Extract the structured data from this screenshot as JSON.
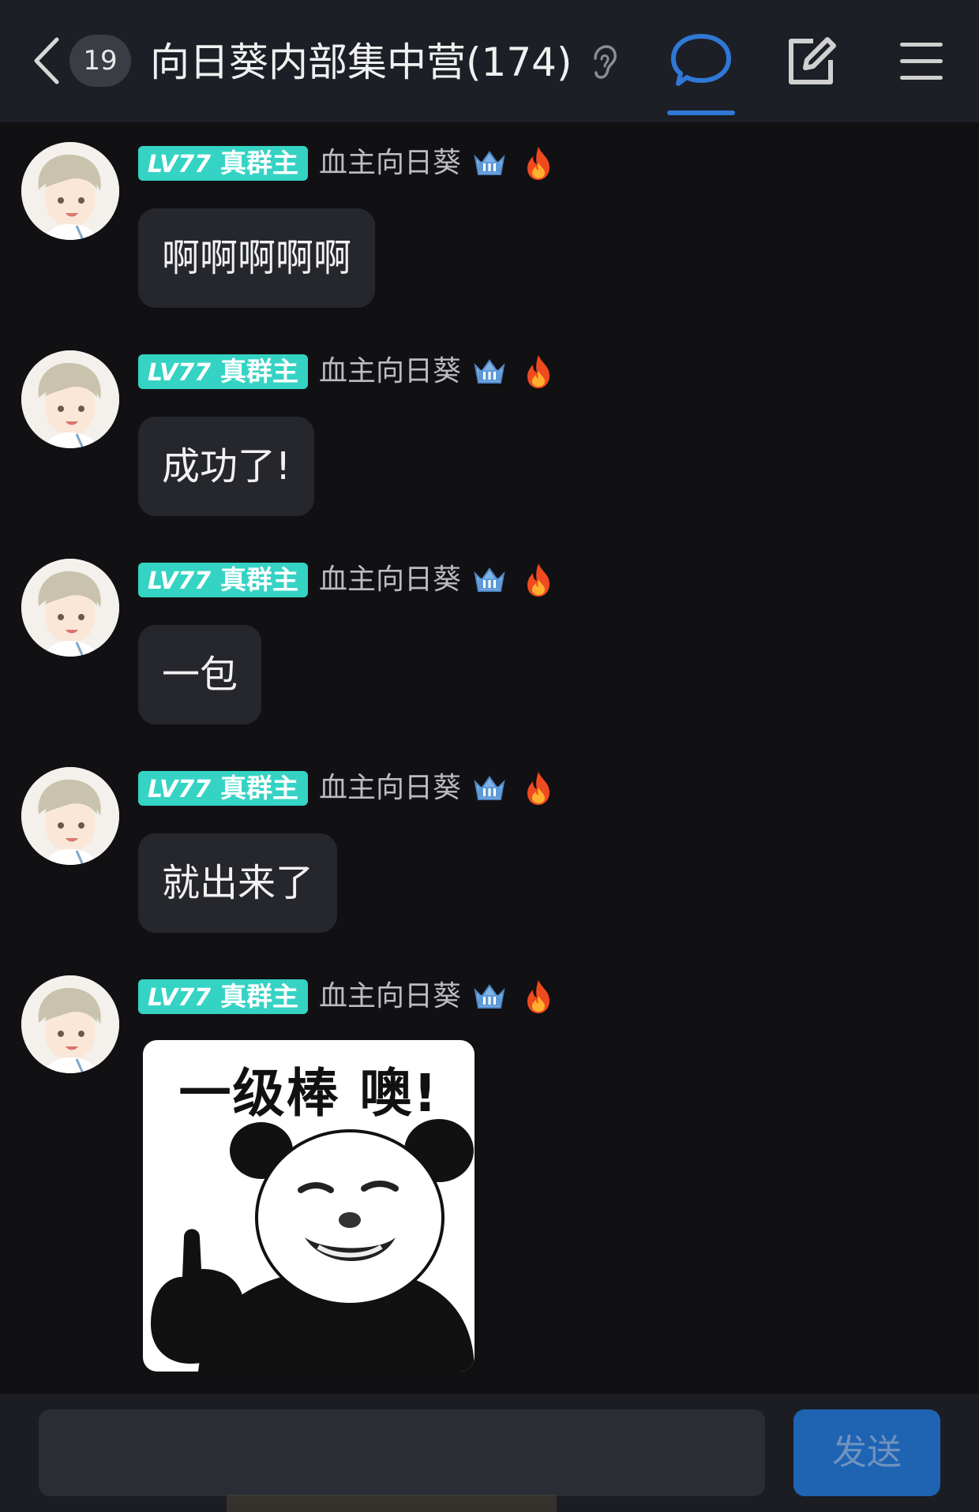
{
  "header": {
    "back_icon": "chevron-left-icon",
    "unread_count": "19",
    "title": "向日葵内部集中营(174)",
    "ear_icon": "ear-icon",
    "chat_icon": "chat-bubble-icon",
    "edit_icon": "edit-icon",
    "menu_icon": "menu-icon",
    "accent_color": "#2f78d6"
  },
  "messages": [
    {
      "level": "LV77",
      "role": "真群主",
      "username": "血主向日葵",
      "text": "啊啊啊啊啊"
    },
    {
      "level": "LV77",
      "role": "真群主",
      "username": "血主向日葵",
      "text": "成功了!"
    },
    {
      "level": "LV77",
      "role": "真群主",
      "username": "血主向日葵",
      "text": "一包"
    },
    {
      "level": "LV77",
      "role": "真群主",
      "username": "血主向日葵",
      "text": "就出来了"
    },
    {
      "level": "LV77",
      "role": "真群主",
      "username": "血主向日葵",
      "sticker_caption": "一级棒  噢!"
    }
  ],
  "input": {
    "placeholder": "",
    "send_label": "发送"
  },
  "colors": {
    "tag_bg": "#35d3c4",
    "bubble_bg": "#25272d",
    "send_bg": "#1f63b3"
  }
}
